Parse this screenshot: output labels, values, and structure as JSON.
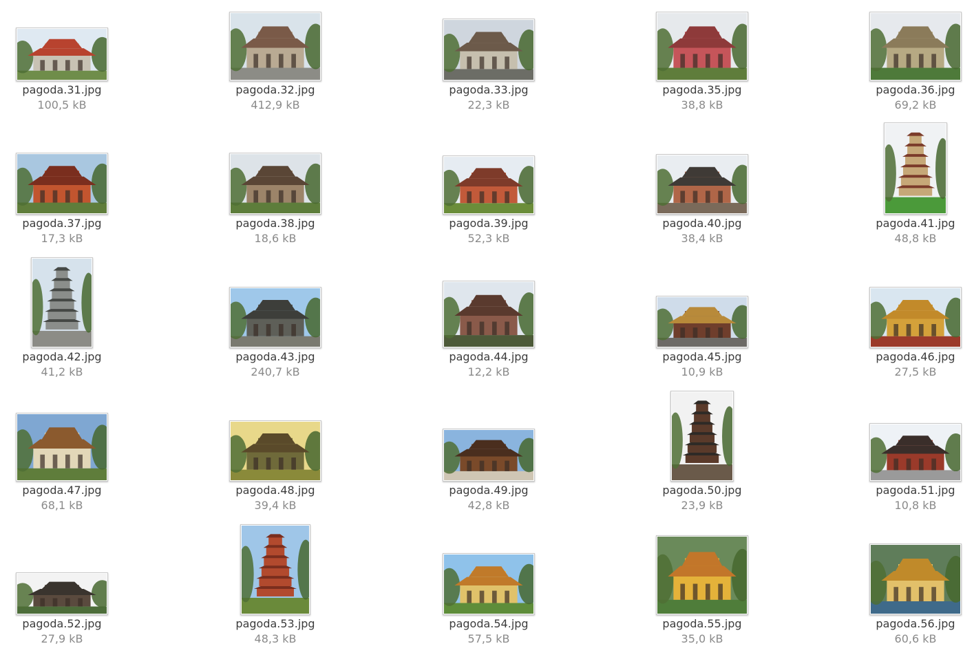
{
  "files": [
    {
      "name": "pagoda.31.jpg",
      "size": "100,5 kB",
      "icon": "image-thumbnail-icon",
      "sky": "#dfe9f2",
      "ground": "#6f8d4a",
      "building": "#c8c2b4",
      "roof": "#b8432f"
    },
    {
      "name": "pagoda.32.jpg",
      "size": "412,9 kB",
      "icon": "image-thumbnail-icon",
      "sky": "#d9e3ea",
      "ground": "#8c8c86",
      "building": "#b9aa93",
      "roof": "#7a5a48"
    },
    {
      "name": "pagoda.33.jpg",
      "size": "22,3 kB",
      "icon": "image-thumbnail-icon",
      "sky": "#cfd6de",
      "ground": "#6c6d66",
      "building": "#c6bfae",
      "roof": "#6c5a4a"
    },
    {
      "name": "pagoda.35.jpg",
      "size": "38,8 kB",
      "icon": "image-thumbnail-icon",
      "sky": "#e6e9ec",
      "ground": "#5f7d3b",
      "building": "#c5555a",
      "roof": "#8e3a3a"
    },
    {
      "name": "pagoda.36.jpg",
      "size": "69,2 kB",
      "icon": "image-thumbnail-icon",
      "sky": "#e6e9ed",
      "ground": "#4e7a3a",
      "building": "#b6a983",
      "roof": "#8b7b5a"
    },
    {
      "name": "pagoda.37.jpg",
      "size": "17,3 kB",
      "icon": "image-thumbnail-icon",
      "sky": "#a9c7e0",
      "ground": "#5f7d3b",
      "building": "#c2552f",
      "roof": "#7a2e1e"
    },
    {
      "name": "pagoda.38.jpg",
      "size": "18,6 kB",
      "icon": "image-thumbnail-icon",
      "sky": "#dde3e8",
      "ground": "#5d7d3b",
      "building": "#9c8469",
      "roof": "#5a4636"
    },
    {
      "name": "pagoda.39.jpg",
      "size": "52,3 kB",
      "icon": "image-thumbnail-icon",
      "sky": "#e6ecf2",
      "ground": "#6b8d3a",
      "building": "#c25a3a",
      "roof": "#7e3b2a"
    },
    {
      "name": "pagoda.40.jpg",
      "size": "38,4 kB",
      "icon": "image-thumbnail-icon",
      "sky": "#e9edf1",
      "ground": "#7a6a5a",
      "building": "#b06648",
      "roof": "#3f3a36"
    },
    {
      "name": "pagoda.41.jpg",
      "size": "48,8 kB",
      "icon": "image-thumbnail-icon",
      "sky": "#f0f2f4",
      "ground": "#4b9a3a",
      "building": "#c6a878",
      "roof": "#7b3b2a"
    },
    {
      "name": "pagoda.42.jpg",
      "size": "41,2 kB",
      "icon": "image-thumbnail-icon",
      "sky": "#d6e2ec",
      "ground": "#8c8c86",
      "building": "#8b8e8b",
      "roof": "#454845"
    },
    {
      "name": "pagoda.43.jpg",
      "size": "240,7 kB",
      "icon": "image-thumbnail-icon",
      "sky": "#9fc8ea",
      "ground": "#7a7a70",
      "building": "#5e5f58",
      "roof": "#3d3e3a"
    },
    {
      "name": "pagoda.44.jpg",
      "size": "12,2 kB",
      "icon": "image-thumbnail-icon",
      "sky": "#dfe6ed",
      "ground": "#4d5a39",
      "building": "#8a5a4a",
      "roof": "#5a3a2e"
    },
    {
      "name": "pagoda.45.jpg",
      "size": "10,9 kB",
      "icon": "image-thumbnail-icon",
      "sky": "#cfdcea",
      "ground": "#6d6a66",
      "building": "#6f3e2c",
      "roof": "#b88a3a"
    },
    {
      "name": "pagoda.46.jpg",
      "size": "27,5 kB",
      "icon": "image-thumbnail-icon",
      "sky": "#d9e6f0",
      "ground": "#9b3a2a",
      "building": "#d4a13a",
      "roof": "#c28a2a"
    },
    {
      "name": "pagoda.47.jpg",
      "size": "68,1 kB",
      "icon": "image-thumbnail-icon",
      "sky": "#7fa7d2",
      "ground": "#5f7d3b",
      "building": "#e2d7b8",
      "roof": "#8b5a2e"
    },
    {
      "name": "pagoda.48.jpg",
      "size": "39,4 kB",
      "icon": "image-thumbnail-icon",
      "sky": "#e8d88a",
      "ground": "#8a8a3a",
      "building": "#6f6a3a",
      "roof": "#5a4a2a"
    },
    {
      "name": "pagoda.49.jpg",
      "size": "42,8 kB",
      "icon": "image-thumbnail-icon",
      "sky": "#8ab4de",
      "ground": "#cfc6b4",
      "building": "#7a4a2a",
      "roof": "#4a2e1e"
    },
    {
      "name": "pagoda.50.jpg",
      "size": "23,9 kB",
      "icon": "image-thumbnail-icon",
      "sky": "#f2f2f2",
      "ground": "#6a5a4a",
      "building": "#5a3a2a",
      "roof": "#2e2a26"
    },
    {
      "name": "pagoda.51.jpg",
      "size": "10,8 kB",
      "icon": "image-thumbnail-icon",
      "sky": "#eef2f6",
      "ground": "#9a9a9a",
      "building": "#9a3a2a",
      "roof": "#3a2e2a"
    },
    {
      "name": "pagoda.52.jpg",
      "size": "27,9 kB",
      "icon": "image-thumbnail-icon",
      "sky": "#f3f3f3",
      "ground": "#4d6d3a",
      "building": "#5a4a3e",
      "roof": "#3a342e"
    },
    {
      "name": "pagoda.53.jpg",
      "size": "48,3 kB",
      "icon": "image-thumbnail-icon",
      "sky": "#9fc6e8",
      "ground": "#6a8a3a",
      "building": "#b24a2e",
      "roof": "#7a2e1e"
    },
    {
      "name": "pagoda.54.jpg",
      "size": "57,5 kB",
      "icon": "image-thumbnail-icon",
      "sky": "#8fc2ea",
      "ground": "#5e8d3a",
      "building": "#e0c26a",
      "roof": "#c07a2a"
    },
    {
      "name": "pagoda.55.jpg",
      "size": "35,0 kB",
      "icon": "image-thumbnail-icon",
      "sky": "#6a8a5a",
      "ground": "#4f7d3a",
      "building": "#e4b23a",
      "roof": "#c2762a"
    },
    {
      "name": "pagoda.56.jpg",
      "size": "60,6 kB",
      "icon": "image-thumbnail-icon",
      "sky": "#5f7d5a",
      "ground": "#3f6a8a",
      "building": "#e2c06a",
      "roof": "#c08a2a"
    }
  ]
}
